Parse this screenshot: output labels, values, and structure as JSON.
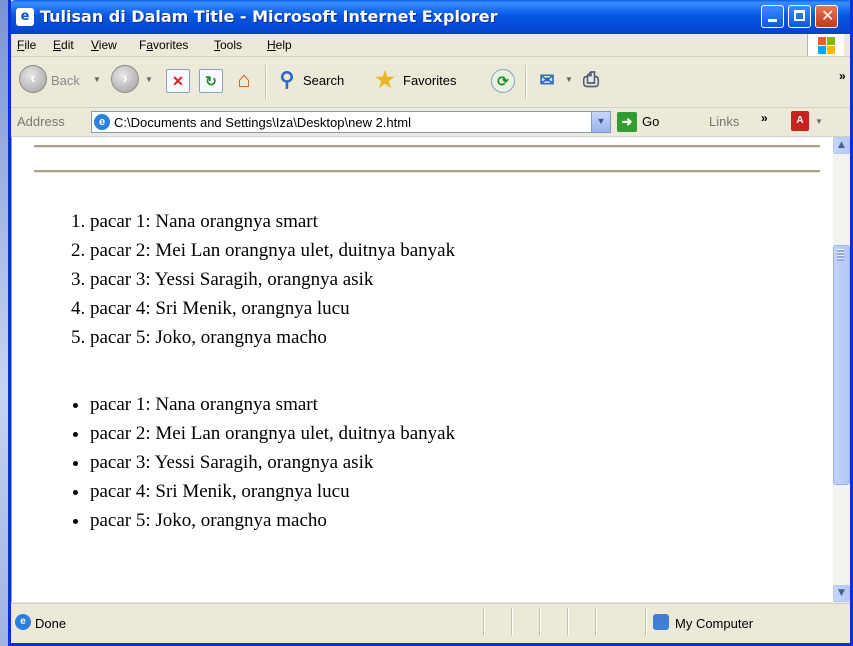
{
  "window": {
    "title": "Tulisan di Dalam Title - Microsoft Internet Explorer"
  },
  "menu": [
    {
      "key": "F",
      "rest": "ile"
    },
    {
      "key": "E",
      "rest": "dit"
    },
    {
      "key": "V",
      "rest": "iew"
    },
    {
      "pre": "F",
      "key": "a",
      "rest": "vorites"
    },
    {
      "key": "T",
      "rest": "ools"
    },
    {
      "key": "H",
      "rest": "elp"
    }
  ],
  "toolbar": {
    "back_label": "Back",
    "search_label": "Search",
    "favorites_label": "Favorites"
  },
  "address": {
    "label": "Address",
    "value": "C:\\Documents and Settings\\Iza\\Desktop\\new 2.html",
    "go_label": "Go",
    "links_label": "Links"
  },
  "content": {
    "ordered_items": [
      "pacar 1: Nana orangnya smart",
      "pacar 2: Mei Lan orangnya ulet, duitnya banyak",
      "pacar 3: Yessi Saragih, orangnya asik",
      "pacar 4: Sri Menik, orangnya lucu",
      "pacar 5: Joko, orangnya macho"
    ],
    "bullet_items": [
      "pacar 1: Nana orangnya smart",
      "pacar 2: Mei Lan orangnya ulet, duitnya banyak",
      "pacar 3: Yessi Saragih, orangnya asik",
      "pacar 4: Sri Menik, orangnya lucu",
      "pacar 5: Joko, orangnya macho"
    ]
  },
  "status": {
    "text": "Done",
    "zone": "My Computer"
  },
  "icons": [
    "ie-icon",
    "back-icon",
    "forward-icon",
    "stop-icon",
    "refresh-icon",
    "home-icon",
    "search-icon",
    "favorites-icon",
    "history-icon",
    "mail-icon",
    "print-icon",
    "go-icon",
    "pdf-icon",
    "computer-icon"
  ]
}
